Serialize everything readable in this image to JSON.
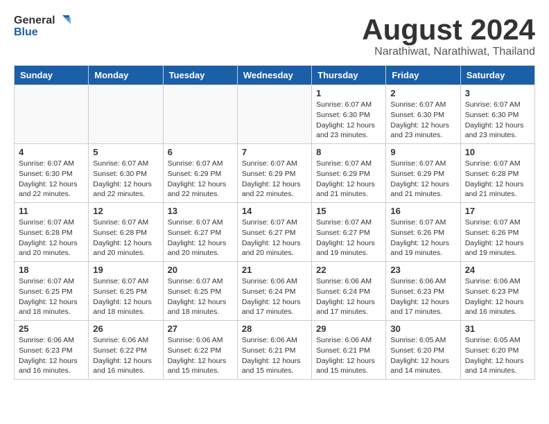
{
  "header": {
    "logo_general": "General",
    "logo_blue": "Blue",
    "month_year": "August 2024",
    "location": "Narathiwat, Narathiwat, Thailand"
  },
  "days_of_week": [
    "Sunday",
    "Monday",
    "Tuesday",
    "Wednesday",
    "Thursday",
    "Friday",
    "Saturday"
  ],
  "weeks": [
    [
      {
        "day": "",
        "info": ""
      },
      {
        "day": "",
        "info": ""
      },
      {
        "day": "",
        "info": ""
      },
      {
        "day": "",
        "info": ""
      },
      {
        "day": "1",
        "info": "Sunrise: 6:07 AM\nSunset: 6:30 PM\nDaylight: 12 hours\nand 23 minutes."
      },
      {
        "day": "2",
        "info": "Sunrise: 6:07 AM\nSunset: 6:30 PM\nDaylight: 12 hours\nand 23 minutes."
      },
      {
        "day": "3",
        "info": "Sunrise: 6:07 AM\nSunset: 6:30 PM\nDaylight: 12 hours\nand 23 minutes."
      }
    ],
    [
      {
        "day": "4",
        "info": "Sunrise: 6:07 AM\nSunset: 6:30 PM\nDaylight: 12 hours\nand 22 minutes."
      },
      {
        "day": "5",
        "info": "Sunrise: 6:07 AM\nSunset: 6:30 PM\nDaylight: 12 hours\nand 22 minutes."
      },
      {
        "day": "6",
        "info": "Sunrise: 6:07 AM\nSunset: 6:29 PM\nDaylight: 12 hours\nand 22 minutes."
      },
      {
        "day": "7",
        "info": "Sunrise: 6:07 AM\nSunset: 6:29 PM\nDaylight: 12 hours\nand 22 minutes."
      },
      {
        "day": "8",
        "info": "Sunrise: 6:07 AM\nSunset: 6:29 PM\nDaylight: 12 hours\nand 21 minutes."
      },
      {
        "day": "9",
        "info": "Sunrise: 6:07 AM\nSunset: 6:29 PM\nDaylight: 12 hours\nand 21 minutes."
      },
      {
        "day": "10",
        "info": "Sunrise: 6:07 AM\nSunset: 6:28 PM\nDaylight: 12 hours\nand 21 minutes."
      }
    ],
    [
      {
        "day": "11",
        "info": "Sunrise: 6:07 AM\nSunset: 6:28 PM\nDaylight: 12 hours\nand 20 minutes."
      },
      {
        "day": "12",
        "info": "Sunrise: 6:07 AM\nSunset: 6:28 PM\nDaylight: 12 hours\nand 20 minutes."
      },
      {
        "day": "13",
        "info": "Sunrise: 6:07 AM\nSunset: 6:27 PM\nDaylight: 12 hours\nand 20 minutes."
      },
      {
        "day": "14",
        "info": "Sunrise: 6:07 AM\nSunset: 6:27 PM\nDaylight: 12 hours\nand 20 minutes."
      },
      {
        "day": "15",
        "info": "Sunrise: 6:07 AM\nSunset: 6:27 PM\nDaylight: 12 hours\nand 19 minutes."
      },
      {
        "day": "16",
        "info": "Sunrise: 6:07 AM\nSunset: 6:26 PM\nDaylight: 12 hours\nand 19 minutes."
      },
      {
        "day": "17",
        "info": "Sunrise: 6:07 AM\nSunset: 6:26 PM\nDaylight: 12 hours\nand 19 minutes."
      }
    ],
    [
      {
        "day": "18",
        "info": "Sunrise: 6:07 AM\nSunset: 6:25 PM\nDaylight: 12 hours\nand 18 minutes."
      },
      {
        "day": "19",
        "info": "Sunrise: 6:07 AM\nSunset: 6:25 PM\nDaylight: 12 hours\nand 18 minutes."
      },
      {
        "day": "20",
        "info": "Sunrise: 6:07 AM\nSunset: 6:25 PM\nDaylight: 12 hours\nand 18 minutes."
      },
      {
        "day": "21",
        "info": "Sunrise: 6:06 AM\nSunset: 6:24 PM\nDaylight: 12 hours\nand 17 minutes."
      },
      {
        "day": "22",
        "info": "Sunrise: 6:06 AM\nSunset: 6:24 PM\nDaylight: 12 hours\nand 17 minutes."
      },
      {
        "day": "23",
        "info": "Sunrise: 6:06 AM\nSunset: 6:23 PM\nDaylight: 12 hours\nand 17 minutes."
      },
      {
        "day": "24",
        "info": "Sunrise: 6:06 AM\nSunset: 6:23 PM\nDaylight: 12 hours\nand 16 minutes."
      }
    ],
    [
      {
        "day": "25",
        "info": "Sunrise: 6:06 AM\nSunset: 6:23 PM\nDaylight: 12 hours\nand 16 minutes."
      },
      {
        "day": "26",
        "info": "Sunrise: 6:06 AM\nSunset: 6:22 PM\nDaylight: 12 hours\nand 16 minutes."
      },
      {
        "day": "27",
        "info": "Sunrise: 6:06 AM\nSunset: 6:22 PM\nDaylight: 12 hours\nand 15 minutes."
      },
      {
        "day": "28",
        "info": "Sunrise: 6:06 AM\nSunset: 6:21 PM\nDaylight: 12 hours\nand 15 minutes."
      },
      {
        "day": "29",
        "info": "Sunrise: 6:06 AM\nSunset: 6:21 PM\nDaylight: 12 hours\nand 15 minutes."
      },
      {
        "day": "30",
        "info": "Sunrise: 6:05 AM\nSunset: 6:20 PM\nDaylight: 12 hours\nand 14 minutes."
      },
      {
        "day": "31",
        "info": "Sunrise: 6:05 AM\nSunset: 6:20 PM\nDaylight: 12 hours\nand 14 minutes."
      }
    ]
  ]
}
